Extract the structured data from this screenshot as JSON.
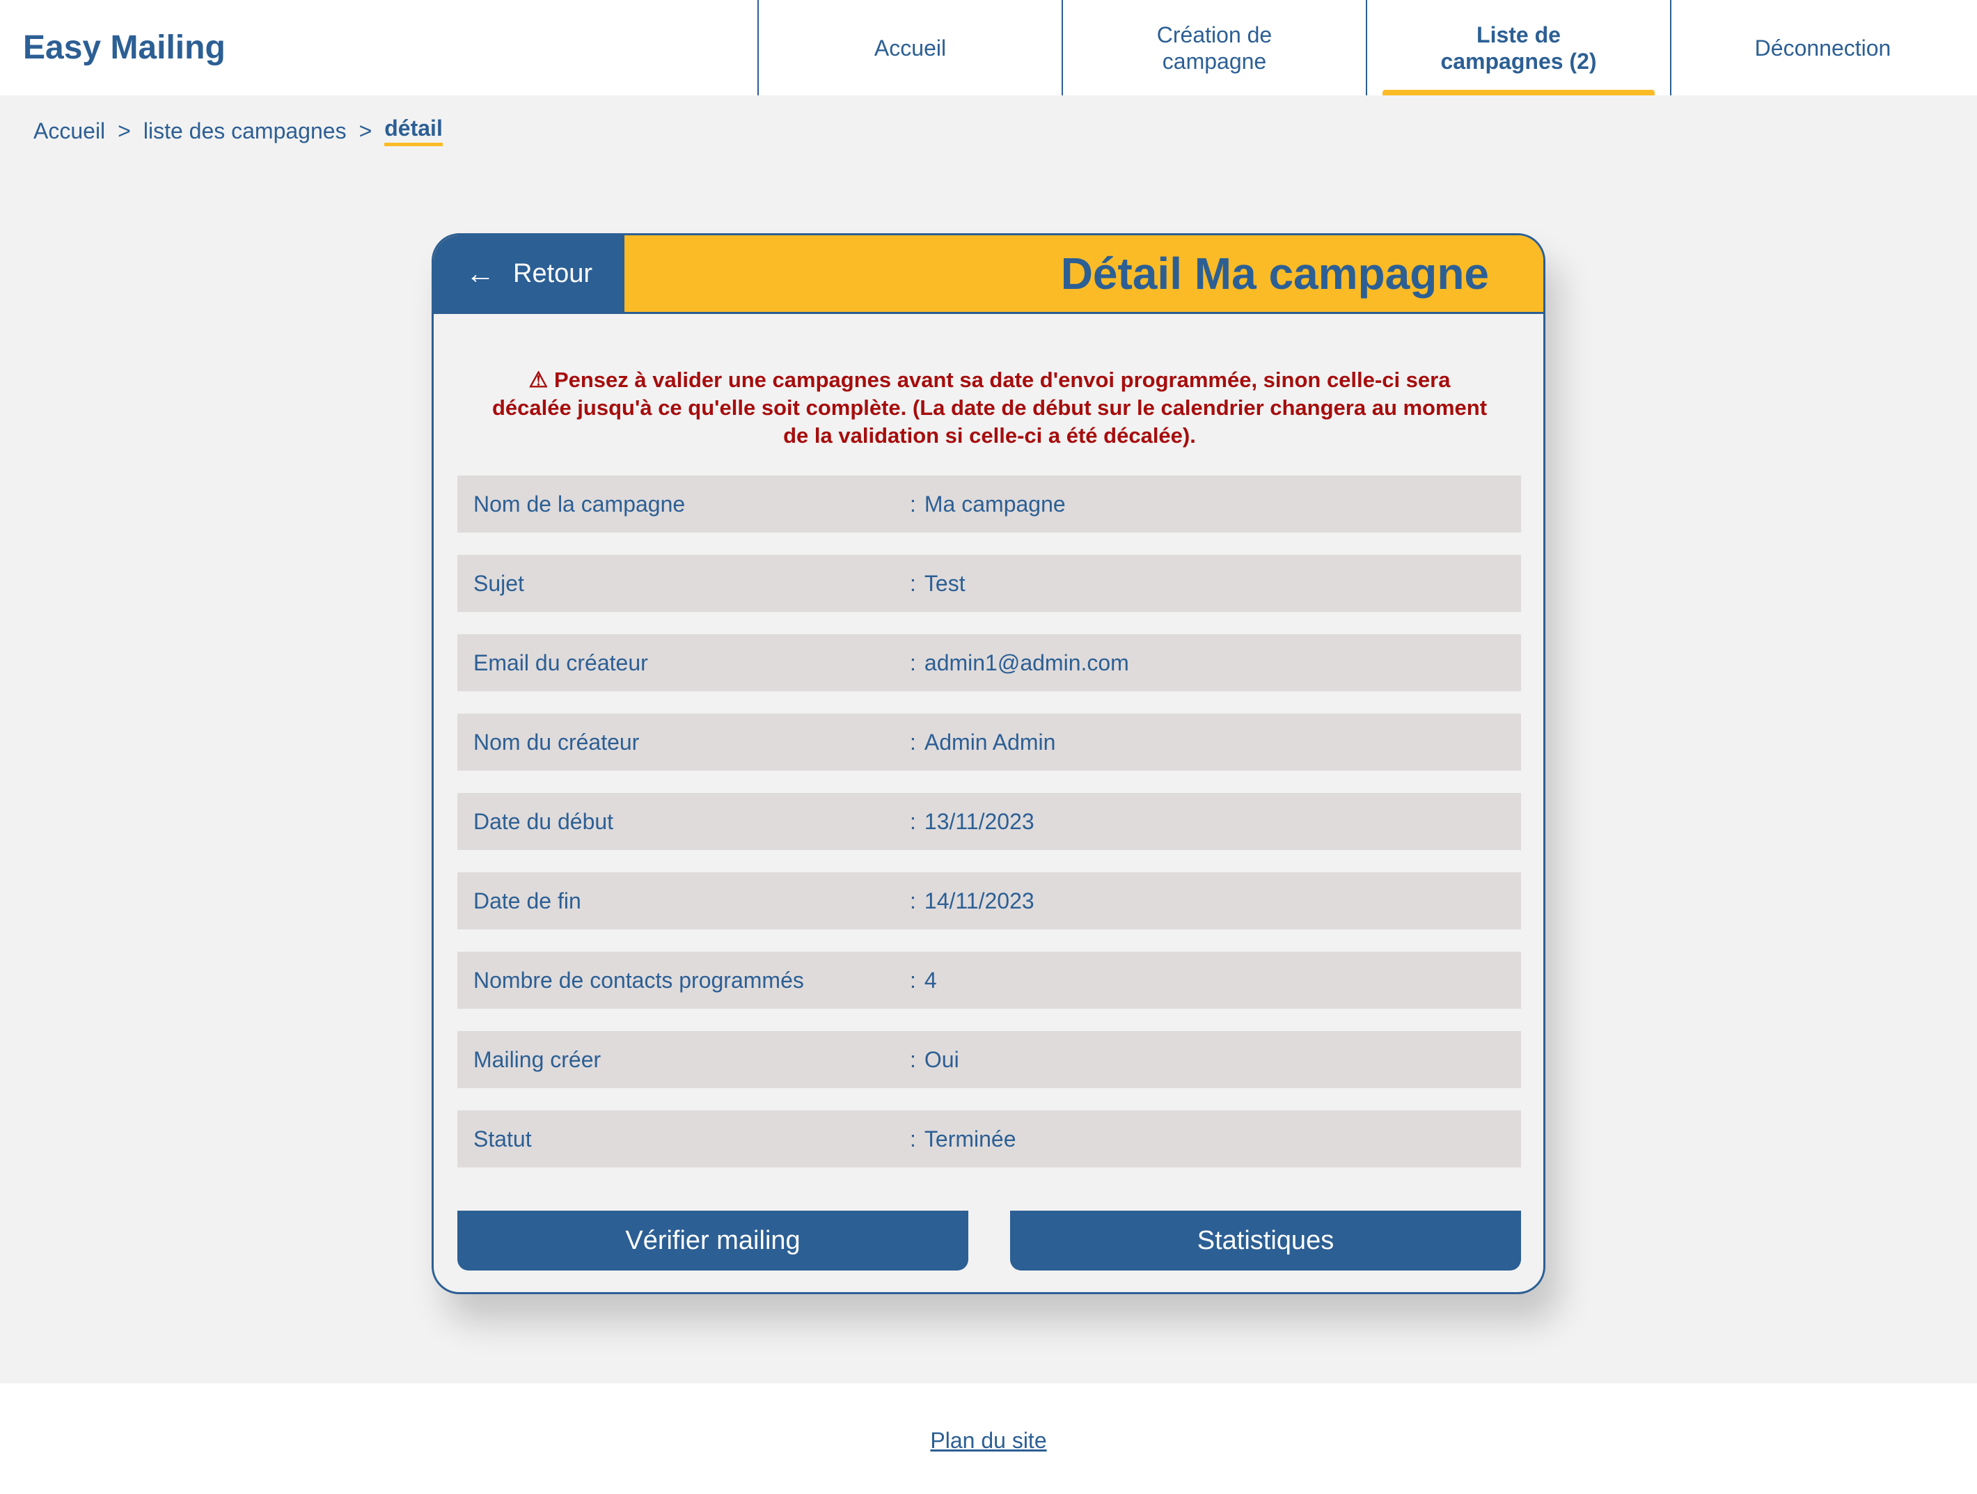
{
  "app": {
    "brand": "Easy Mailing"
  },
  "nav": {
    "items": [
      {
        "label": "Accueil"
      },
      {
        "label": "Création de campagne"
      },
      {
        "label": "Liste de campagnes (2)"
      },
      {
        "label": "Déconnection"
      }
    ],
    "active_index": 2
  },
  "breadcrumb": {
    "items": [
      "Accueil",
      "liste des campagnes",
      "détail"
    ],
    "separator": ">"
  },
  "card": {
    "back_label": "Retour",
    "back_icon": "left-arrow-icon",
    "title": "Détail Ma campagne",
    "warning_icon": "warning-icon",
    "warning": "Pensez à valider une campagnes avant sa date d'envoi programmée, sinon celle-ci sera décalée jusqu'à ce qu'elle soit complète. (La date de début sur le calendrier changera au moment de la validation si celle-ci a été décalée).",
    "fields": [
      {
        "label": "Nom de la campagne",
        "value": "Ma campagne"
      },
      {
        "label": "Sujet",
        "value": "Test"
      },
      {
        "label": "Email du créateur",
        "value": "admin1@admin.com"
      },
      {
        "label": "Nom du créateur",
        "value": "Admin Admin"
      },
      {
        "label": "Date du début",
        "value": "13/11/2023"
      },
      {
        "label": "Date de fin",
        "value": "14/11/2023"
      },
      {
        "label": "Nombre de contacts programmés",
        "value": "4"
      },
      {
        "label": "Mailing créer",
        "value": "Oui"
      },
      {
        "label": "Statut",
        "value": "Terminée"
      }
    ],
    "actions": {
      "verify_label": "Vérifier mailing",
      "stats_label": "Statistiques"
    }
  },
  "footer": {
    "sitemap_label": "Plan du site"
  },
  "colors": {
    "primary": "#2c5f94",
    "accent": "#fbbb27",
    "warning": "#a60d0d",
    "row_bg": "#dfdbdb",
    "page_bg": "#f2f2f2"
  }
}
